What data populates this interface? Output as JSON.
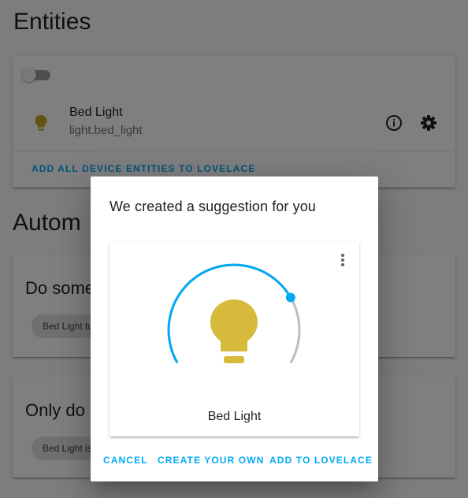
{
  "page": {
    "title": "Entities",
    "automations_title": "Autom"
  },
  "entities_card": {
    "entity": {
      "name": "Bed Light",
      "entity_id": "light.bed_light",
      "icon": "lightbulb-icon"
    },
    "actions": {
      "info_icon": "info-icon",
      "settings_icon": "gear-icon",
      "add_all_label": "ADD ALL DEVICE ENTITIES TO LOVELACE"
    }
  },
  "automations": [
    {
      "title": "Do some",
      "chip": "Bed Light tu"
    },
    {
      "title": "Only do",
      "chip": "Bed Light is"
    }
  ],
  "dialog": {
    "title": "We created a suggestion for you",
    "light_card": {
      "name": "Bed Light",
      "brightness_fraction": 0.75,
      "menu_icon": "more-vert-icon"
    },
    "buttons": {
      "cancel": "CANCEL",
      "create_own": "CREATE YOUR OWN",
      "add_lovelace": "ADD TO LOVELACE"
    }
  },
  "colors": {
    "accent": "#03a9f4",
    "bulb_on": "#d7b93b",
    "bulb_small": "#c6a92a",
    "slider_track": "#bdbdbd"
  }
}
